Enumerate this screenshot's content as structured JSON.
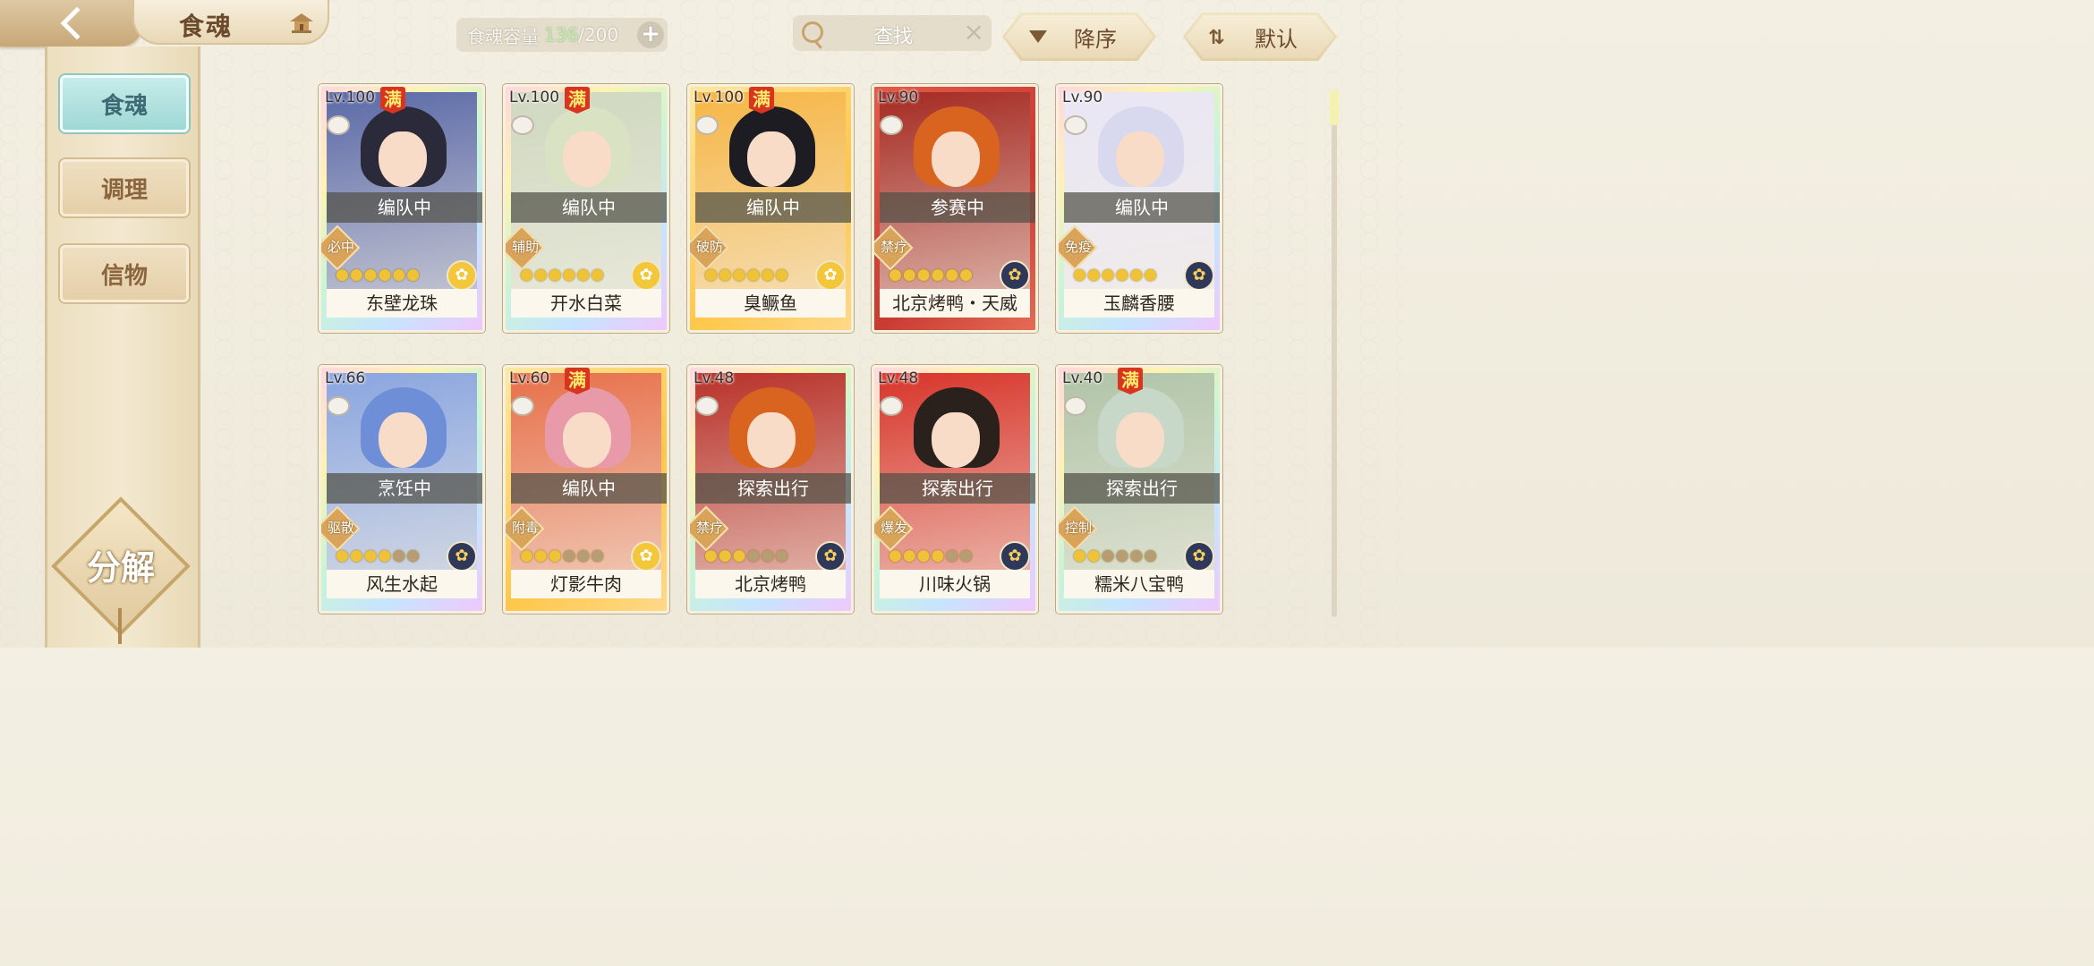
{
  "header": {
    "title": "食魂",
    "capacity_label": "食魂容量",
    "capacity_current": "136",
    "capacity_sep": "/",
    "capacity_max": "200",
    "search_placeholder": "查找",
    "sort_order": "降序",
    "sort_default": "默认"
  },
  "sidebar": {
    "tabs": [
      {
        "label": "食魂",
        "active": true
      },
      {
        "label": "调理",
        "active": false
      },
      {
        "label": "信物",
        "active": false
      }
    ],
    "decompose_label": "分解"
  },
  "cards": [
    {
      "level": "Lv.100",
      "full": "满",
      "status": "编队中",
      "role": "必中",
      "stars": 6,
      "name": "东壁龙珠",
      "frame": "rainbow"
    },
    {
      "level": "Lv.100",
      "full": "满",
      "status": "编队中",
      "role": "辅助",
      "stars": 6,
      "name": "开水白菜",
      "frame": "rainbow"
    },
    {
      "level": "Lv.100",
      "full": "满",
      "status": "编队中",
      "role": "破防",
      "stars": 6,
      "name": "臭鳜鱼",
      "frame": "gold"
    },
    {
      "level": "Lv.90",
      "full": "",
      "status": "参赛中",
      "role": "禁疗",
      "stars": 6,
      "name": "北京烤鸭・天威",
      "frame": "red"
    },
    {
      "level": "Lv.90",
      "full": "",
      "status": "编队中",
      "role": "免疫",
      "stars": 6,
      "name": "玉麟香腰",
      "frame": "rainbow"
    },
    {
      "level": "Lv.66",
      "full": "",
      "status": "烹饪中",
      "role": "驱散",
      "stars": 4,
      "name": "风生水起",
      "frame": "rainbow"
    },
    {
      "level": "Lv.60",
      "full": "满",
      "status": "编队中",
      "role": "附毒",
      "stars": 3,
      "name": "灯影牛肉",
      "frame": "gold"
    },
    {
      "level": "Lv.48",
      "full": "",
      "status": "探索出行",
      "role": "禁疗",
      "stars": 3,
      "name": "北京烤鸭",
      "frame": "rainbow"
    },
    {
      "level": "Lv.48",
      "full": "",
      "status": "探索出行",
      "role": "爆发",
      "stars": 4,
      "name": "川味火锅",
      "frame": "rainbow"
    },
    {
      "level": "Lv.40",
      "full": "满",
      "status": "探索出行",
      "role": "控制",
      "stars": 2,
      "name": "糯米八宝鸭",
      "frame": "rainbow"
    }
  ],
  "colors": {
    "accent_teal": "#9fd8d5",
    "gold": "#d9a45a",
    "full_badge": "#d8341f",
    "capacity_current": "#b8f0a8"
  }
}
